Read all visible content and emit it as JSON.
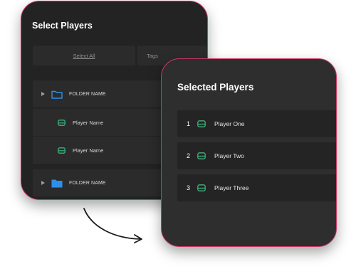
{
  "select_players": {
    "title": "Select Players",
    "select_all_label": "Select All",
    "tags_label": "Tags",
    "rows": [
      {
        "type": "folder",
        "label": "FOLDER NAME",
        "icon": "folder-outline-icon"
      },
      {
        "type": "player",
        "label": "Player Name",
        "icon": "player-device-icon"
      },
      {
        "type": "player",
        "label": "Player Name",
        "icon": "player-device-icon"
      },
      {
        "type": "folder",
        "label": "FOLDER NAME",
        "icon": "folder-filled-icon"
      }
    ]
  },
  "selected_players": {
    "title": "Selected Players",
    "items": [
      {
        "index": "1",
        "label": "Player One",
        "icon": "player-device-icon"
      },
      {
        "index": "2",
        "label": "Player Two",
        "icon": "player-device-icon"
      },
      {
        "index": "3",
        "label": "Player Three",
        "icon": "player-device-icon"
      }
    ]
  },
  "colors": {
    "accent_border": "#c73a63",
    "folder_blue": "#2f8fe8",
    "player_green": "#3fb27f"
  }
}
